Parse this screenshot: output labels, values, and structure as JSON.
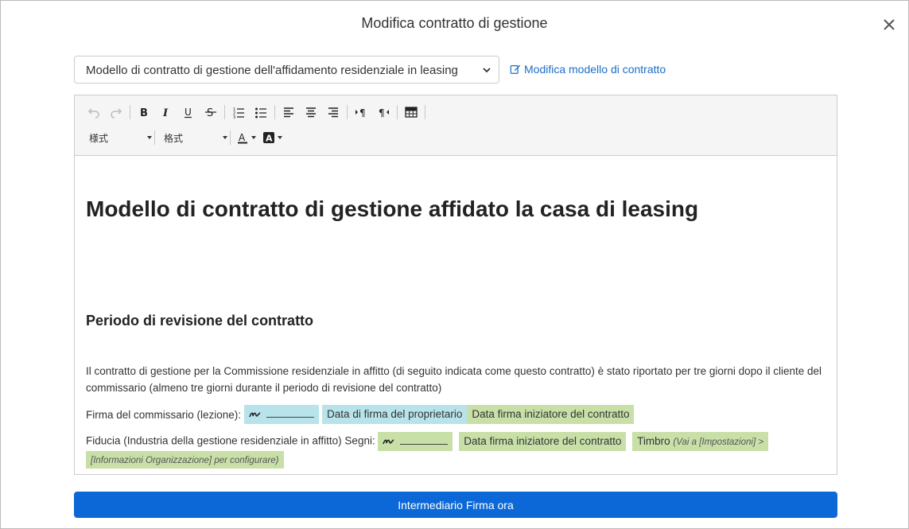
{
  "modal": {
    "title": "Modifica contratto di gestione"
  },
  "template_select": {
    "value": "Modello di contratto di gestione dell'affidamento residenziale in leasing"
  },
  "edit_template_link": "Modifica modello di contratto",
  "toolbar": {
    "style_dropdown": "様式",
    "format_dropdown": "格式"
  },
  "document": {
    "title": "Modello di contratto di gestione affidato la casa di leasing",
    "section_heading": "Periodo di revisione del contratto",
    "paragraph": "Il contratto di gestione per la Commissione residenziale in affitto (di seguito indicata come questo contratto) è stato riportato per tre giorni dopo il cliente del commissario (almeno tre giorni durante il periodo di revisione del contratto)",
    "line1": {
      "label": "Firma del commissario (lezione):",
      "chip_owner_date": "Data di firma del proprietario",
      "chip_initiator_date": "Data firma iniziatore del contratto"
    },
    "line2": {
      "label": "Fiducia (Industria della gestione residenziale in affitto) Segni:",
      "chip_initiator_date": "Data firma iniziatore del contratto",
      "stamp_label": "Timbro",
      "stamp_hint_1": "(Vai a [Impostazioni] >",
      "stamp_hint_2": "[Informazioni Organizzazione] per configurare)"
    }
  },
  "sign_button": "Intermediario Firma ora",
  "colors": {
    "primary": "#0b68d6",
    "chip_blue": "#b8e3ea",
    "chip_green": "#c8e0a8",
    "link": "#1a6fc9"
  }
}
